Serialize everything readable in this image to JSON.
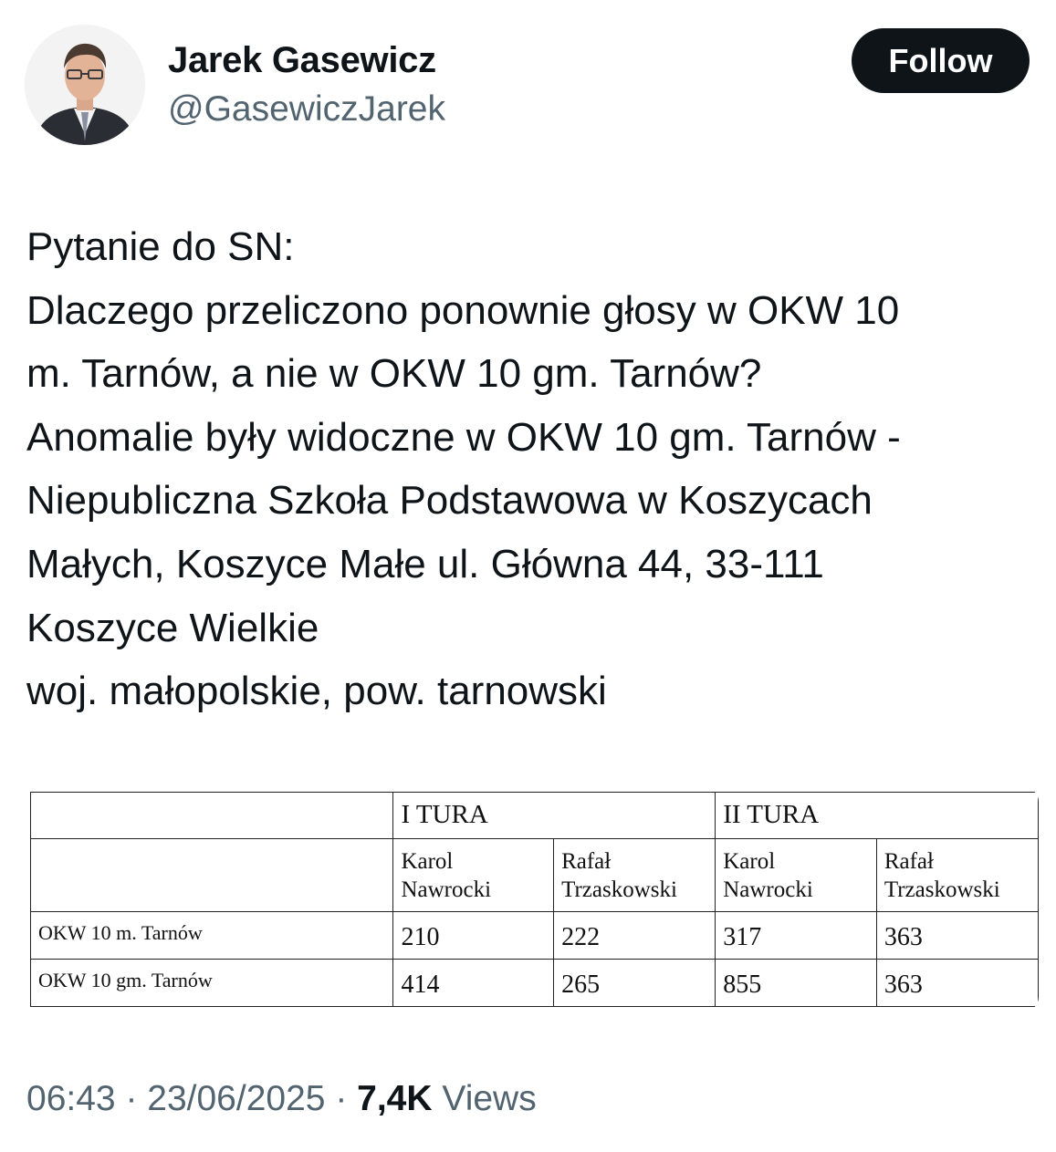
{
  "author": {
    "display_name": "Jarek Gasewicz",
    "handle": "@GasewiczJarek"
  },
  "follow_label": "Follow",
  "tweet": {
    "lines": [
      "Pytanie do SN:",
      "Dlaczego przeliczono ponownie głosy w OKW 10",
      "m. Tarnów, a nie w OKW 10 gm. Tarnów?",
      "Anomalie były widoczne w OKW 10 gm. Tarnów -",
      "Niepubliczna Szkoła Podstawowa w Koszycach",
      "Małych, Koszyce Małe ul. Główna 44, 33-111",
      "Koszyce Wielkie",
      "woj. małopolskie, pow. tarnowski"
    ]
  },
  "table": {
    "round1": "I TURA",
    "round2": "II TURA",
    "candidates": [
      {
        "first": "Karol",
        "last": "Nawrocki"
      },
      {
        "first": "Rafał",
        "last": "Trzaskowski"
      },
      {
        "first": "Karol",
        "last": "Nawrocki"
      },
      {
        "first": "Rafał",
        "last": "Trzaskowski"
      }
    ],
    "rows": [
      {
        "label": "OKW 10 m. Tarnów",
        "values": [
          "210",
          "222",
          "317",
          "363"
        ]
      },
      {
        "label": "OKW 10 gm. Tarnów",
        "values": [
          "414",
          "265",
          "855",
          "363"
        ]
      }
    ]
  },
  "meta": {
    "time": "06:43",
    "separator": " · ",
    "date": "23/06/2025",
    "views_count": "7,4K",
    "views_label": "Views"
  }
}
